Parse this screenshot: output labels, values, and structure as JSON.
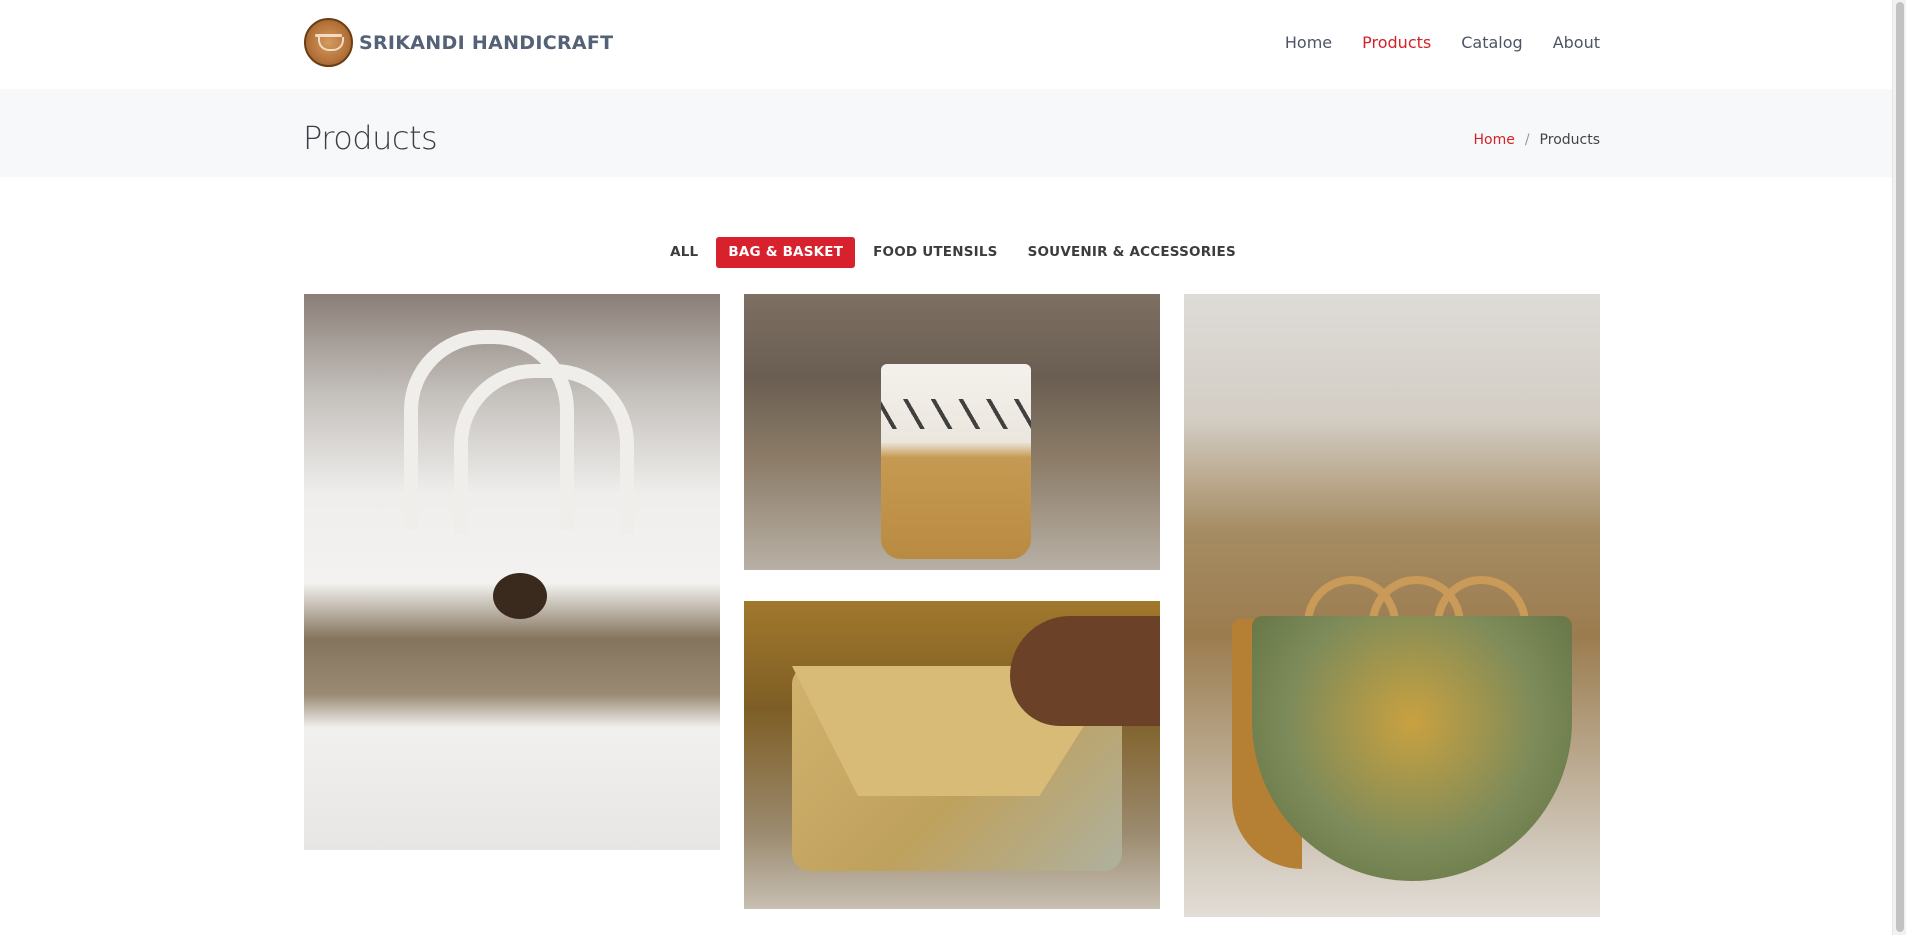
{
  "brand": {
    "name": "SRIKANDI HANDICRAFT",
    "logo_icon": "srikandi-logo-icon"
  },
  "nav": {
    "items": [
      {
        "label": "Home",
        "active": false
      },
      {
        "label": "Products",
        "active": true
      },
      {
        "label": "Catalog",
        "active": false
      },
      {
        "label": "About",
        "active": false
      }
    ]
  },
  "page": {
    "title": "Products"
  },
  "breadcrumb": {
    "home": "Home",
    "separator": "/",
    "current": "Products"
  },
  "filters": {
    "items": [
      {
        "label": "ALL",
        "active": false
      },
      {
        "label": "BAG & BASKET",
        "active": true
      },
      {
        "label": "FOOD UTENSILS",
        "active": false
      },
      {
        "label": "SOUVENIR & ACCESSORIES",
        "active": false
      }
    ]
  },
  "gallery": {
    "items": [
      {
        "subject": "white-brown-striped-woven-tote-bag"
      },
      {
        "subject": "woven-basket-with-zigzag-pattern"
      },
      {
        "subject": "woven-clutch-bag-held-in-hand"
      },
      {
        "subject": "woven-half-moon-handbag"
      }
    ]
  },
  "colors": {
    "accent": "#d7222d",
    "nav_text": "#4d5566",
    "band_bg": "#f7f8f9"
  }
}
